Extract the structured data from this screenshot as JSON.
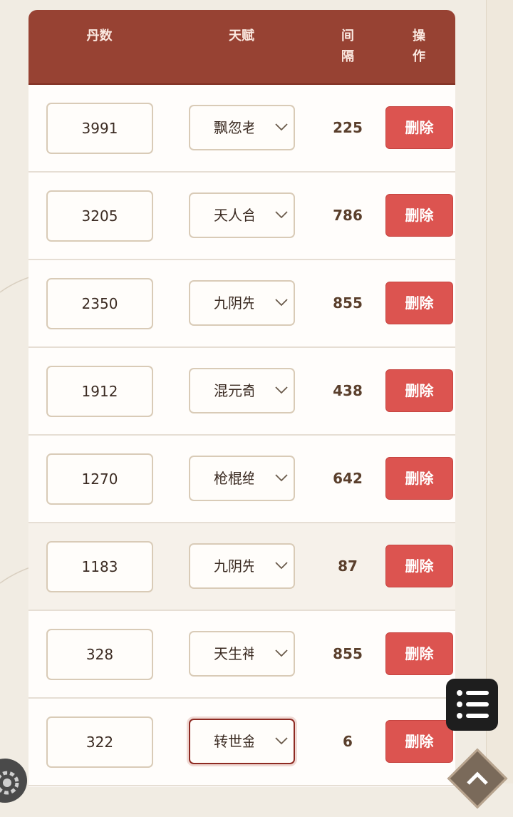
{
  "table": {
    "headers": {
      "dan_count": "丹数",
      "talent": "天赋",
      "interval_line1": "间",
      "interval_line2": "隔",
      "action_line1": "操",
      "action_line2": "作"
    },
    "rows": [
      {
        "dan": "3991",
        "talent": "飘忽老",
        "interval": "225",
        "delete": "删除"
      },
      {
        "dan": "3205",
        "talent": "天人合",
        "interval": "786",
        "delete": "删除"
      },
      {
        "dan": "2350",
        "talent": "九阴先",
        "interval": "855",
        "delete": "删除"
      },
      {
        "dan": "1912",
        "talent": "混元奇",
        "interval": "438",
        "delete": "删除"
      },
      {
        "dan": "1270",
        "talent": "枪棍绝",
        "interval": "642",
        "delete": "删除"
      },
      {
        "dan": "1183",
        "talent": "九阴先",
        "interval": "87",
        "delete": "删除"
      },
      {
        "dan": "328",
        "talent": "天生神",
        "interval": "855",
        "delete": "删除"
      },
      {
        "dan": "322",
        "talent": "转世金",
        "interval": "6",
        "delete": "删除"
      }
    ]
  },
  "icons": {
    "menu": "list-menu-icon",
    "scroll_top": "chevron-up-icon",
    "settings": "gear-icon"
  },
  "colors": {
    "header": "#974233",
    "delete_button": "#dc5450",
    "background": "#f1ece3"
  }
}
